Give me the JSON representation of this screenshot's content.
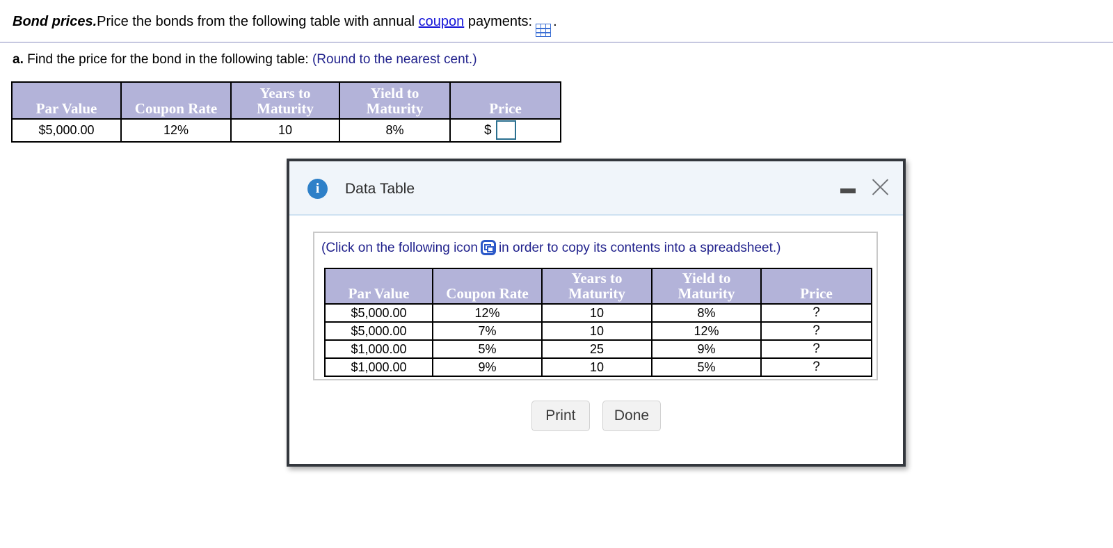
{
  "question": {
    "title": "Bond prices.",
    "text_before_link": "Price the bonds from the following table with annual ",
    "link_label": "coupon",
    "text_after_link": " payments:",
    "grid_icon_name": "table-grid-icon",
    "trailing_period": "."
  },
  "part_a": {
    "label": "a.",
    "text": "Find the price for the bond in the following table:",
    "note": "(Round to the nearest cent.)"
  },
  "main_table": {
    "headers": [
      "Par Value",
      "Coupon Rate",
      "Years to Maturity",
      "Yield to Maturity",
      "Price"
    ],
    "headers_wrapped": [
      [
        "",
        "Par Value"
      ],
      [
        "",
        "Coupon Rate"
      ],
      [
        "Years to",
        "Maturity"
      ],
      [
        "Yield to",
        "Maturity"
      ],
      [
        "",
        "Price"
      ]
    ],
    "row": {
      "par_value": "$5,000.00",
      "coupon_rate": "12%",
      "years_to_maturity": "10",
      "yield_to_maturity": "8%",
      "price_prefix": "$",
      "price_value": "",
      "price_placeholder": ""
    }
  },
  "dialog": {
    "title": "Data Table",
    "info_icon_glyph": "i",
    "minimize_label": "Minimize",
    "close_label": "Close",
    "copy_hint_before": "(Click on the following icon",
    "copy_hint_after": "in order to copy its contents into a spreadsheet.)",
    "copy_icon_name": "copy-to-spreadsheet-icon",
    "table": {
      "headers_wrapped": [
        [
          "",
          "Par Value"
        ],
        [
          "",
          "Coupon Rate"
        ],
        [
          "Years to",
          "Maturity"
        ],
        [
          "Yield to",
          "Maturity"
        ],
        [
          "",
          "Price"
        ]
      ],
      "rows": [
        {
          "par_value": "$5,000.00",
          "coupon_rate": "12%",
          "years_to_maturity": "10",
          "yield_to_maturity": "8%",
          "price": "?"
        },
        {
          "par_value": "$5,000.00",
          "coupon_rate": "7%",
          "years_to_maturity": "10",
          "yield_to_maturity": "12%",
          "price": "?"
        },
        {
          "par_value": "$1,000.00",
          "coupon_rate": "5%",
          "years_to_maturity": "25",
          "yield_to_maturity": "9%",
          "price": "?"
        },
        {
          "par_value": "$1,000.00",
          "coupon_rate": "9%",
          "years_to_maturity": "10",
          "yield_to_maturity": "5%",
          "price": "?"
        }
      ]
    },
    "buttons": {
      "print": "Print",
      "done": "Done"
    }
  },
  "colors": {
    "table_header_bg": "#b3b3d9",
    "link_blue": "#1414d8",
    "note_blue": "#20218c",
    "dialog_border": "#33373d",
    "dialog_header_bg": "#f0f5fa",
    "info_icon_blue": "#2e80c8",
    "input_border": "#2b7090",
    "copy_icon_blue": "#2b58c8"
  }
}
